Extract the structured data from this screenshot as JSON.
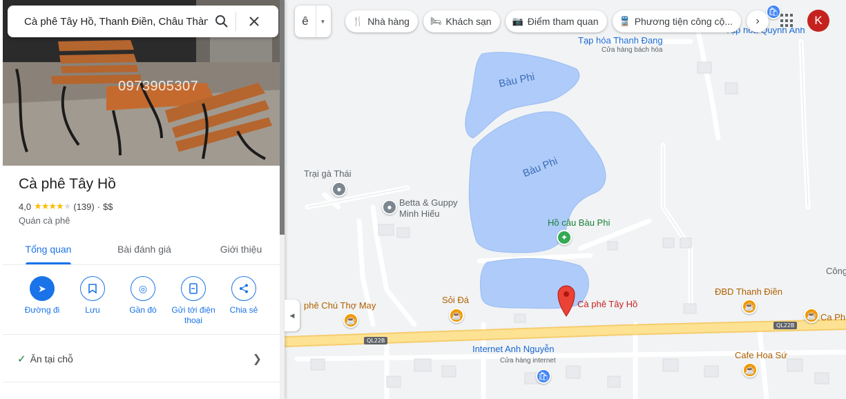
{
  "search": {
    "value": "Cà phê Tây Hồ, Thanh Điền, Châu Thàn"
  },
  "photo": {
    "watermark": "0973905307"
  },
  "place": {
    "title": "Cà phê Tây Hồ",
    "rating": "4,0",
    "rating_value": 4.0,
    "review_count": "(139)",
    "separator": "·",
    "price": "$$",
    "category": "Quán cà phê"
  },
  "tabs": [
    {
      "label": "Tổng quan",
      "active": true
    },
    {
      "label": "Bài đánh giá",
      "active": false
    },
    {
      "label": "Giới thiệu",
      "active": false
    }
  ],
  "actions": [
    {
      "label": "Đường đi",
      "icon": "directions-icon"
    },
    {
      "label": "Lưu",
      "icon": "bookmark-icon"
    },
    {
      "label": "Gần đó",
      "icon": "nearby-icon"
    },
    {
      "label": "Gửi tới điện thoại",
      "icon": "send-to-phone-icon"
    },
    {
      "label": "Chia sẻ",
      "icon": "share-icon"
    }
  ],
  "dine_in": {
    "label": "Ăn tại chỗ"
  },
  "layer_button": {
    "label": "ê"
  },
  "chips": [
    {
      "label": "Nhà hàng",
      "icon": "restaurant-icon"
    },
    {
      "label": "Khách sạn",
      "icon": "hotel-icon"
    },
    {
      "label": "Điểm tham quan",
      "icon": "camera-icon"
    },
    {
      "label": "Phương tiện công cộ...",
      "icon": "transit-icon"
    }
  ],
  "user": {
    "initial": "K"
  },
  "colors": {
    "accent": "#1a73e8",
    "water": "#aecbfa",
    "highway": "#fde293",
    "selected_pin": "#ea4335",
    "cafe_pin": "#f29900"
  },
  "map": {
    "labels": {
      "tap_hoa_thanh_dang": "Tạp hóa Thanh Đang",
      "tap_hoa_thanh_dang_sub": "Cửa hàng bách hóa",
      "tap_hoa_quynh_anh": "Tạp hóa Quỳnh Anh",
      "trai_ga_thai": "Trại gà Thái",
      "betta_guppy_1": "Betta & Guppy",
      "betta_guppy_2": "Minh Hiếu",
      "ho_cau_bau_phi": "Hồ câu Bàu Phi",
      "cong": "Công",
      "ca_phe_chu_tho_may": "phê Chú Thợ May",
      "soi_da": "Sỏi Đá",
      "ca_phe_tay_ho": "Cà phê Tây Hồ",
      "dbd_thanh_dien": "ĐBD Thanh Điền",
      "ca_ph": "Ca Ph",
      "internet_anh_nguyen": "Internet Anh Nguyễn",
      "internet_anh_nguyen_sub": "Cửa hàng internet",
      "cafe_hoa_su": "Cafe Hoa Sứ"
    },
    "lakes": [
      "Bàu Phi",
      "Bàu Phi"
    ],
    "road_shields": [
      "QL22B",
      "QL22B"
    ]
  }
}
